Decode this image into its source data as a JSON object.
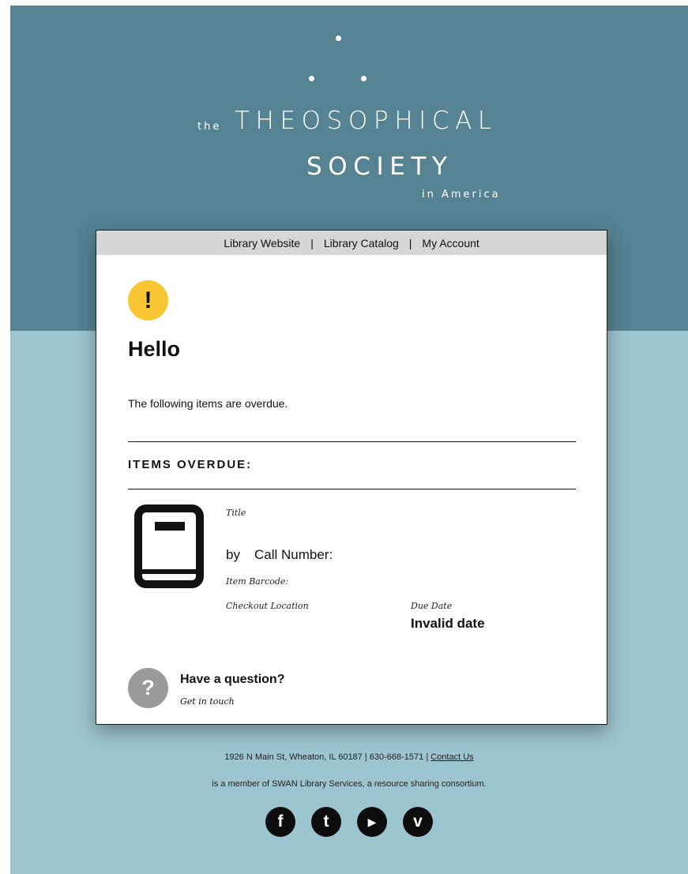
{
  "logo": {
    "the": "the",
    "theosophical": "THEOSOPHICAL",
    "society": "SOCIETY",
    "in_america": "in America"
  },
  "nav": {
    "library_website": "Library Website",
    "separator": "|",
    "library_catalog": "Library Catalog",
    "my_account": "My Account"
  },
  "alert": {
    "icon_symbol": "!",
    "icon_color": "#f7c632"
  },
  "greeting": "Hello",
  "intro": "The following items are overdue.",
  "section_title": "ITEMS OVERDUE:",
  "item": {
    "title_label": "Title",
    "by_label": "by",
    "call_number_label": "Call Number:",
    "barcode_label": "Item Barcode:",
    "checkout_location_label": "Checkout Location",
    "due_date_label": "Due Date",
    "due_date_value": "Invalid date",
    "icon": "book-icon"
  },
  "question": {
    "icon_symbol": "?",
    "title": "Have a question?",
    "link": "Get in touch"
  },
  "footer": {
    "address": "1926 N Main St, Wheaton, IL 60187 | 630-668-1571 |",
    "contact": "Contact Us",
    "membership": "is a member of SWAN Library Services, a resource sharing consortium.",
    "social": [
      {
        "name": "facebook",
        "glyph": "f"
      },
      {
        "name": "twitter",
        "glyph": "t"
      },
      {
        "name": "youtube",
        "glyph": "▶"
      },
      {
        "name": "vimeo",
        "glyph": "v"
      }
    ]
  },
  "colors": {
    "header_band": "#568391",
    "page_background": "#9dc5cf",
    "nav_background": "#d6d6d6"
  }
}
